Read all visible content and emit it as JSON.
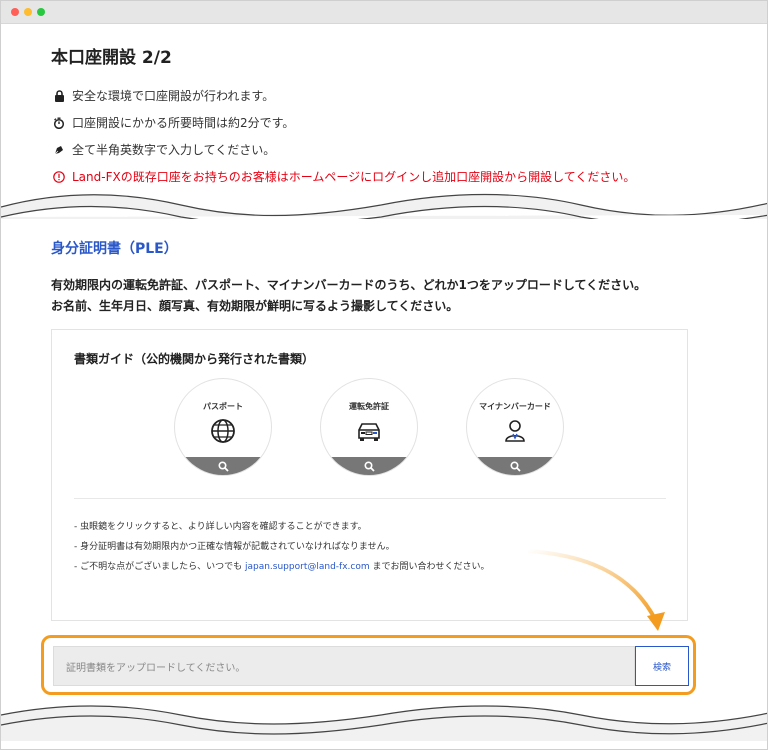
{
  "window": {
    "controls": [
      "close",
      "minimize",
      "maximize"
    ]
  },
  "page_title": "本口座開設 2/2",
  "info_lines": [
    {
      "icon": "lock-icon",
      "text": "安全な環境で口座開設が行われます。"
    },
    {
      "icon": "timer-icon",
      "text": "口座開設にかかる所要時間は約2分です。"
    },
    {
      "icon": "pen-icon",
      "text": "全て半角英数字で入力してください。"
    },
    {
      "icon": "alert-icon",
      "text": "Land-FXの既存口座をお持ちのお客様はホームページにログインし追加口座開設から開設してください。"
    }
  ],
  "section": {
    "title": "身分証明書（PLE）",
    "desc_1": "有効期限内の運転免許証、パスポート、マイナンバーカードのうち、どれか1つをアップロードしてください。",
    "desc_2": "お名前、生年月日、顔写真、有効期限が鮮明に写るよう撮影してください。"
  },
  "guide": {
    "title": "書類ガイド（公的機関から発行された書類）",
    "cards": [
      {
        "label": "パスポート",
        "icon": "globe-icon"
      },
      {
        "label": "運転免許証",
        "icon": "car-icon"
      },
      {
        "label": "マイナンバーカード",
        "icon": "person-icon"
      }
    ],
    "notes": {
      "n1": "- 虫眼鏡をクリックすると、より詳しい内容を確認することができます。",
      "n2": "- 身分証明書は有効期限内かつ正確な情報が記載されていなければなりません。",
      "n3_pre": "- ご不明な点がございましたら、いつでも ",
      "n3_email": "japan.support@land-fx.com",
      "n3_post": " までお問い合わせください。"
    }
  },
  "upload": {
    "placeholder": "証明書類をアップロードしてください。",
    "button": "検索"
  },
  "colors": {
    "accent_blue": "#2a57c9",
    "alert_red": "#e50012",
    "highlight_orange": "#f39c1f"
  }
}
